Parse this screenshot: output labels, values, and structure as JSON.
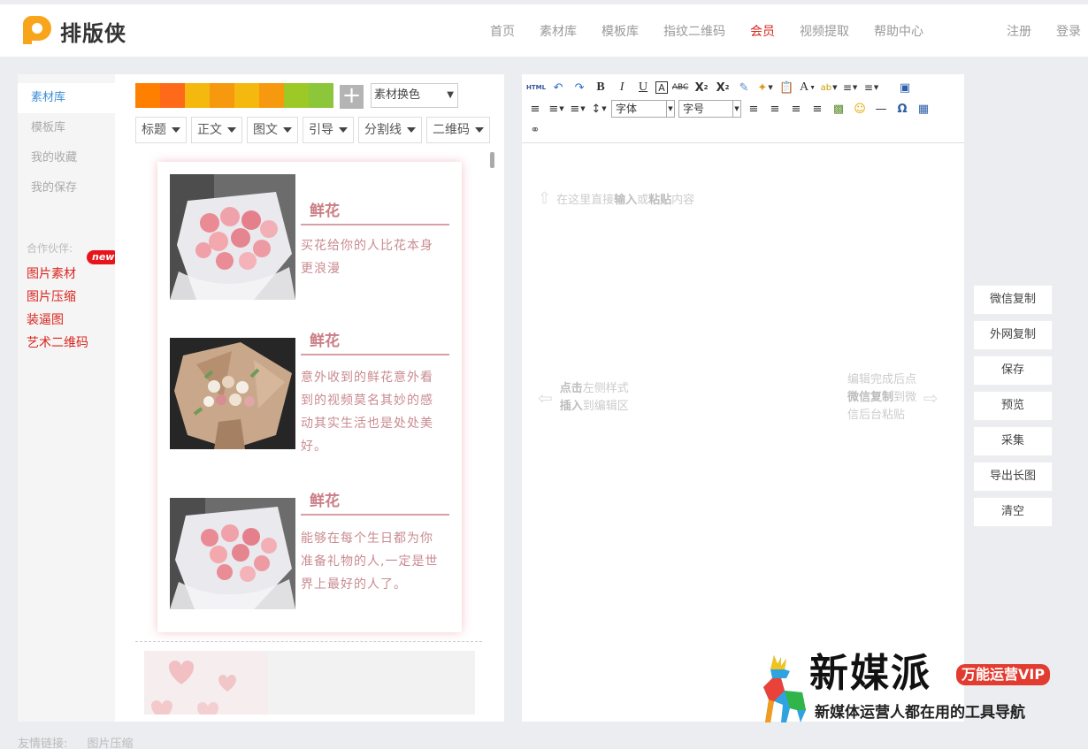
{
  "logo": {
    "text": "排版侠"
  },
  "nav": {
    "items": [
      "首页",
      "素材库",
      "模板库",
      "指纹二维码",
      "会员",
      "视频提取",
      "帮助中心"
    ],
    "vip_index": 4,
    "register": "注册",
    "login": "登录"
  },
  "sidebar": {
    "items": [
      "素材库",
      "模板库",
      "我的收藏",
      "我的保存"
    ],
    "partners_label": "合作伙伴:",
    "partners": [
      "图片素材",
      "图片压缩",
      "装逼图",
      "艺术二维码"
    ],
    "new_badge": "new"
  },
  "panel": {
    "swatches": [
      "#ff7f00",
      "#ff6a1a",
      "#f5b80f",
      "#f7990f",
      "#f5b80f",
      "#f7990f",
      "#9cc926",
      "#8cc63a"
    ],
    "plus": "+",
    "color_select": "素材换色",
    "filters": [
      "标题",
      "正文",
      "图文",
      "引导",
      "分割线",
      "二维码"
    ],
    "materials": [
      {
        "title": "鲜花",
        "text": "买花给你的人比花本身更浪漫"
      },
      {
        "title": "鲜花",
        "text": "意外收到的鲜花意外看到的视频莫名其妙的感动其实生活也是处处美好。"
      },
      {
        "title": "鲜花",
        "text": "能够在每个生日都为你准备礼物的人,一定是世界上最好的人了。"
      }
    ]
  },
  "editor": {
    "toolbar": {
      "html": "HTML",
      "font_family": "字体",
      "font_size": "字号"
    },
    "hint_top": {
      "pre": "在这里直接",
      "b1": "输入",
      "mid": "或",
      "b2": "粘贴",
      "post": "内容"
    },
    "hint_left": {
      "b1": "点击",
      "t1": "左侧样式",
      "b2": "插入",
      "t2": "到编辑区"
    },
    "hint_right": {
      "t1": "编辑完成后点",
      "b1": "微信复制",
      "t2": "到微",
      "t3": "信后台粘贴"
    }
  },
  "actions": [
    "微信复制",
    "外网复制",
    "保存",
    "预览",
    "采集",
    "导出长图",
    "清空"
  ],
  "watermark": {
    "title": "新媒派",
    "vip": "万能运营VIP",
    "subtitle": "新媒体运营人都在用的工具导航"
  },
  "footer": {
    "label": "友情链接:",
    "link": "图片压缩"
  }
}
